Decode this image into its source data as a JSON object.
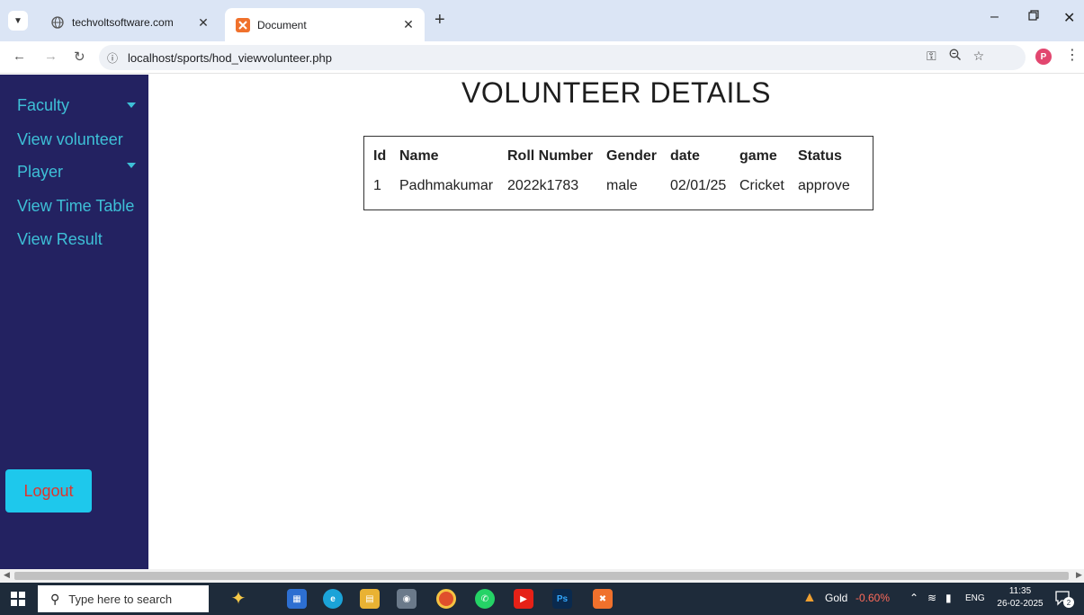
{
  "browser": {
    "tabs": [
      {
        "title": "techvoltsoftware.com",
        "active": false
      },
      {
        "title": "Document",
        "active": true
      }
    ],
    "url": "localhost/sports/hod_viewvolunteer.php"
  },
  "sidebar": {
    "items": [
      {
        "label": "Faculty",
        "dropdown": true
      },
      {
        "label": "View volunteer",
        "dropdown": false
      },
      {
        "label": "Player",
        "dropdown": true
      },
      {
        "label": "View Time Table",
        "dropdown": false
      },
      {
        "label": "View Result",
        "dropdown": false
      }
    ],
    "logout_label": "Logout"
  },
  "main": {
    "title": "VOLUNTEER DETAILS",
    "table": {
      "headers": [
        "Id",
        "Name",
        "Roll Number",
        "Gender",
        "date",
        "game",
        "Status"
      ],
      "rows": [
        [
          "1",
          "Padhmakumar",
          "2022k1783",
          "male",
          "02/01/25",
          "Cricket",
          "approve"
        ]
      ]
    }
  },
  "taskbar": {
    "search_placeholder": "Type here to search",
    "gold_label": "Gold",
    "gold_change": "-0.60%",
    "language": "ENG",
    "time": "11:35",
    "date": "26-02-2025",
    "notification_count": "2"
  },
  "colors": {
    "sidebar_bg": "#232261",
    "sidebar_text": "#3ec0d7",
    "logout_bg": "#1ec8ec",
    "logout_text": "#e0342c"
  }
}
